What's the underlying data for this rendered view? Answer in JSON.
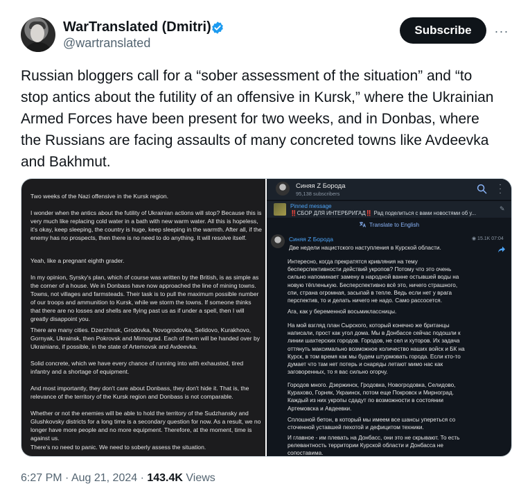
{
  "author": {
    "name": "WarTranslated (Dmitri)",
    "handle": "@wartranslated",
    "subscribe_label": "Subscribe",
    "more_label": "···"
  },
  "tweet": {
    "text": "Russian bloggers call for a “sober assessment of the situation” and “to stop antics about the futility of an offensive in Kursk,” where the Ukrainian Armed Forces have been present for two weeks, and in Donbas, where the Russians are facing assaults of many concreted towns like Avdeevka and Bakhmut."
  },
  "media_left": {
    "paragraphs": [
      "Two weeks of the Nazi offensive in the Kursk region.",
      "I wonder when the antics about the futility of Ukrainian actions will stop? Because this is very much like replacing cold water in a bath with new warm water. All this is hopeless, it's okay, keep sleeping, the country is huge, keep sleeping in the warmth. After all, if the enemy has no prospects, then there is no need to do anything. It will resolve itself.",
      "Yeah, like a pregnant eighth grader.",
      "In my opinion, Syrsky's plan, which of course was written by the British, is as simple as the corner of a house. We in Donbass have now approached the line of mining towns. Towns, not villages and farmsteads. Their task is to pull the maximum possible number of our troops and ammunition to Kursk, while we storm the towns. If someone thinks that there are no losses and shells are flying past us as if under a spell, then I will greatly disappoint you.",
      "There are many cities. Dzerzhinsk, Grodovka, Novogrodovka, Selidovo, Kurakhovo, Gornyak, Ukrainsk, then Pokrovsk and Mirnograd. Each of them will be handed over by Ukrainians, if possible, in the state of Artemovsk and Avdeevka.",
      "Solid concrete, which we have every chance of running into with exhausted, tired infantry and a shortage of equipment.",
      "And most importantly, they don't care about Donbass, they don't hide it. That is, the relevance of the territory of the Kursk region and Donbass is not comparable.",
      "Whether or not the enemies will be able to hold the territory of the Sudzhansky and Glushkovsky districts for a long time is a secondary question for now. As a result, we no longer have more people and no more equipment. Therefore, at the moment, time is against us.",
      "There's no need to panic. We need to soberly assess the situation."
    ]
  },
  "media_right": {
    "channel_name": "Синяя Z Борода",
    "subscribers": "95,138 subscribers",
    "pinned_label": "Pinned message",
    "pinned_text": "‼️СБОР ДЛЯ ИНТЕРБРИГАД‼️  Рад поделиться с вами новостями об у...",
    "translate_label": "Translate to English",
    "post_author": "Синяя Z Борода",
    "post_meta": "◉ 15.1K 07:04",
    "post_first": "Две недели нацистского наступления в Курской области.",
    "paragraphs": [
      "Интересно, когда прекратятся кривляния на тему бесперспективности действий укропов? Потому что это очень сильно напоминает замену в народной ванне остывшей воды на новую тёпленькую. Бесперспективно всё это, ничего страшного, спи, страна огромная, засыпай в тепле. Ведь если нет у врага перспектив, то и делать ничего не надо. Само рассосется.",
      "Ага, как у беременной восьмиклассницы.",
      "На мой взгляд план Сырского, который конечно же британцы написали, прост как угол дома. Мы в Донбассе сейчас подошли к линии шахтерских городов. Городов, не сел и хуторов. Их задача оттянуть максимально возможное количество наших войск и БК на Курск, в том время как мы будем штурмовать города. Если кто-то думает что там нет потерь и снаряды летают мимо нас как заговоренных, то я вас сильно огорчу.",
      "Городов много. Дзержинск, Гродовка, Новогродовка, Селидово, Курахово, Горняк, Украинск, потом еще Покровск и Мирноград. Каждый из них укропы сдадут по возможности в состоянии Артемовска и Авдеевки.",
      "Сплошной бетон, в который мы имеем все шансы упереться со сточенной уставшей пехотой и дефицитом техники.",
      "И главное - им плевать на Донбасс, они это не скрывают. То есть релевантность территории Курской области и Донбасса не сопоставима."
    ]
  },
  "footer": {
    "time": "6:27 PM",
    "separator": " · ",
    "date": "Aug 21, 2024",
    "separator2": " · ",
    "views_count": "143.4K",
    "views_label": " Views"
  },
  "colors": {
    "brand_blue": "#1d9bf0",
    "text": "#0f1419",
    "muted": "#536471"
  }
}
